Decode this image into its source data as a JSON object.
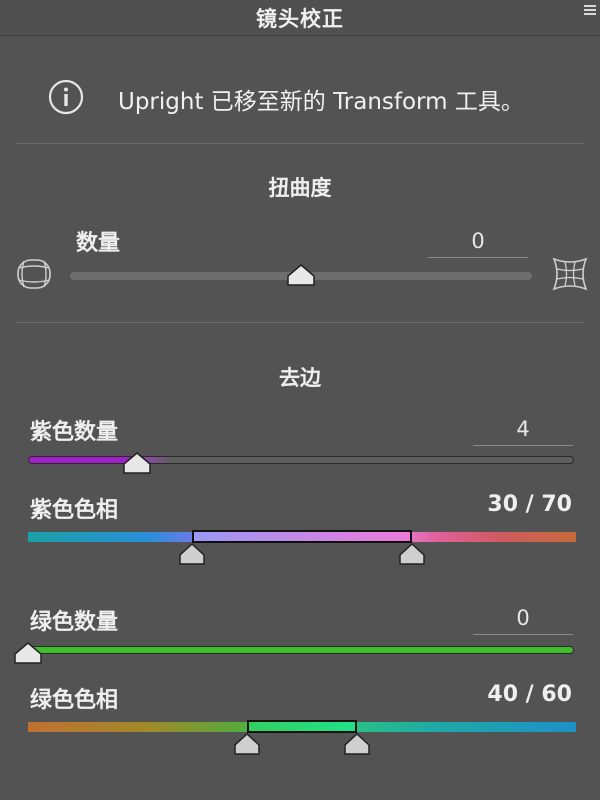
{
  "panel": {
    "title": "镜头校正",
    "notice_text": "Upright 已移至新的 Transform 工具。"
  },
  "distortion": {
    "section_title": "扭曲度",
    "amount_label": "数量",
    "amount_value": "0",
    "amount_fraction": 0.5,
    "left_icon": "barrel-distortion-icon",
    "right_icon": "pincushion-distortion-icon"
  },
  "defringe": {
    "section_title": "去边",
    "purple_amount_label": "紫色数量",
    "purple_amount_value": "4",
    "purple_amount_fraction": 0.2,
    "purple_hue_label": "紫色色相",
    "purple_hue_value": "30 / 70",
    "purple_hue_range": [
      30,
      70
    ],
    "green_amount_label": "绿色数量",
    "green_amount_value": "0",
    "green_amount_fraction": 0,
    "green_hue_label": "绿色色相",
    "green_hue_value": "40 / 60",
    "green_hue_range": [
      40,
      60
    ]
  },
  "colors": {
    "purple_track": "#a020c8",
    "green_track": "#3fbf2a",
    "background": "#535353"
  }
}
